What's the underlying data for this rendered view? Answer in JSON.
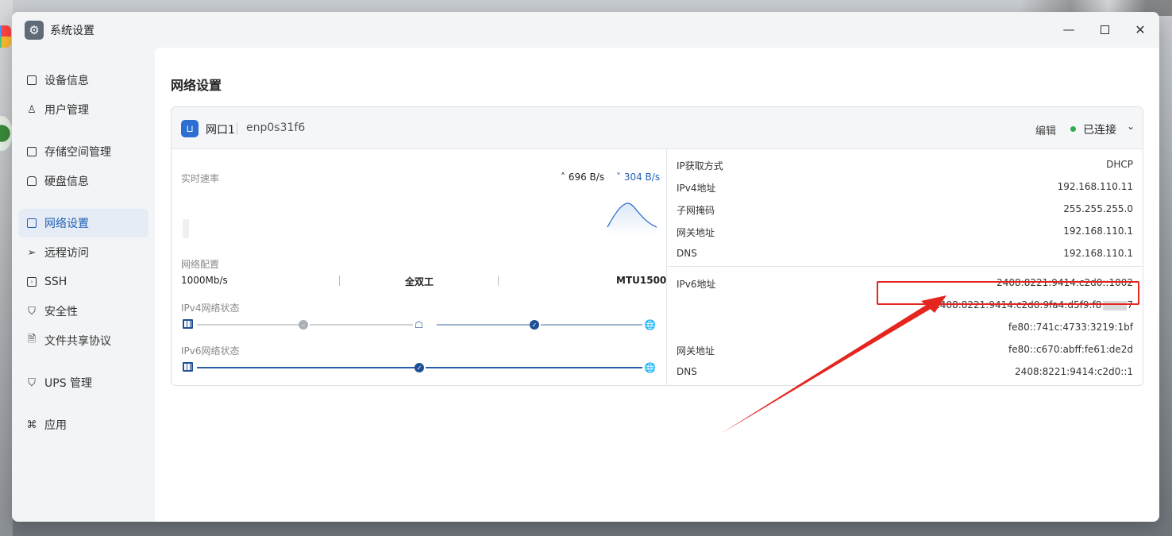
{
  "window": {
    "title": "系统设置",
    "icons": {
      "app": "gear-icon",
      "minimize": "minimize-icon",
      "maximize": "maximize-icon",
      "close": "close-icon"
    }
  },
  "sidebar": {
    "items": [
      {
        "label": "设备信息",
        "icon": "device-icon",
        "active": false
      },
      {
        "label": "用户管理",
        "icon": "user-icon",
        "active": false
      },
      {
        "label": "存储空间管理",
        "icon": "storage-icon",
        "active": false
      },
      {
        "label": "硬盘信息",
        "icon": "disk-icon",
        "active": false
      },
      {
        "label": "网络设置",
        "icon": "network-icon",
        "active": true
      },
      {
        "label": "远程访问",
        "icon": "remote-icon",
        "active": false
      },
      {
        "label": "SSH",
        "icon": "ssh-icon",
        "active": false
      },
      {
        "label": "安全性",
        "icon": "shield-icon",
        "active": false
      },
      {
        "label": "文件共享协议",
        "icon": "file-share-icon",
        "active": false
      },
      {
        "label": "UPS 管理",
        "icon": "ups-icon",
        "active": false
      },
      {
        "label": "应用",
        "icon": "apps-icon",
        "active": false
      }
    ]
  },
  "page": {
    "title": "网络设置"
  },
  "port": {
    "name": "网口1",
    "device": "enp0s31f6",
    "edit_label": "编辑",
    "status": "已连接",
    "status_color": "#2fae4f"
  },
  "realtime": {
    "label": "实时速率",
    "upload": "696 B/s",
    "download": "304 B/s"
  },
  "config": {
    "label": "网络配置",
    "speed": "1000Mb/s",
    "duplex": "全双工",
    "mtu": "MTU1500"
  },
  "ipv4_status": {
    "label": "IPv4网络状态"
  },
  "ipv6_status": {
    "label": "IPv6网络状态"
  },
  "ipv4": {
    "rows": [
      {
        "label": "IP获取方式",
        "value": "DHCP"
      },
      {
        "label": "IPv4地址",
        "value": "192.168.110.11"
      },
      {
        "label": "子网掩码",
        "value": "255.255.255.0"
      },
      {
        "label": "网关地址",
        "value": "192.168.110.1"
      },
      {
        "label": "DNS",
        "value": "192.168.110.1"
      }
    ]
  },
  "ipv6": {
    "address_label": "IPv6地址",
    "addresses": [
      "2408:8221:9414:c2d0::1002",
      "2408:8221:9414:c2d0:9fa4:d5f9:f8",
      "fe80::741c:4733:3219:1bf"
    ],
    "address2_suffix": "7",
    "gateway_label": "网关地址",
    "gateway": "fe80::c670:abff:fe61:de2d",
    "dns_label": "DNS",
    "dns": "2408:8221:9414:c2d0::1"
  },
  "colors": {
    "accent": "#1f5fb4",
    "annotation": "#e5261f"
  }
}
